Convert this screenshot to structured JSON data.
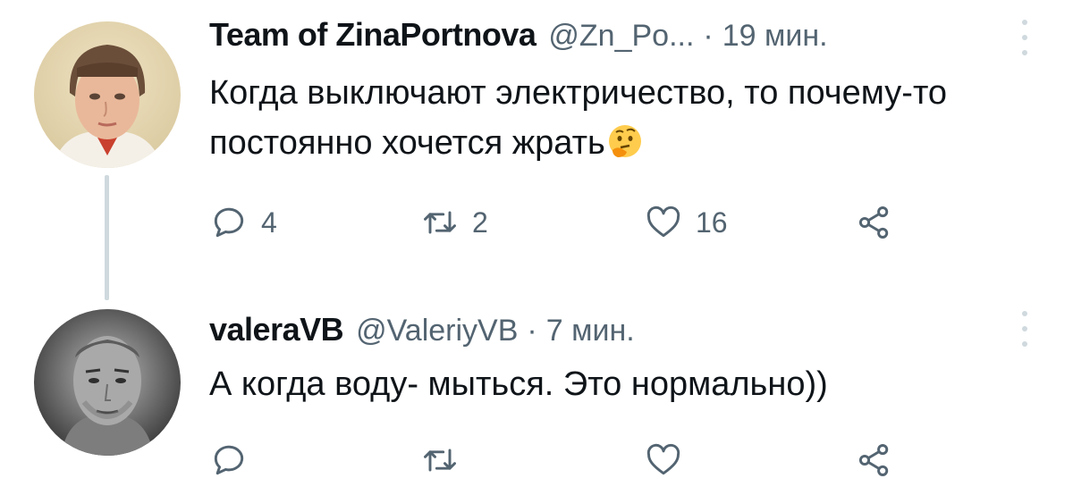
{
  "tweets": [
    {
      "name": "Team of ZinaPortnova",
      "handle": "@Zn_Po...",
      "separator": "·",
      "time": "19 мин.",
      "text": "Когда выключают электричество, то почему-то постоянно хочется жрать",
      "emoji": "thinking-face",
      "avatar": "girl-portrait",
      "actions": {
        "replies": "4",
        "retweets": "2",
        "likes": "16"
      }
    },
    {
      "name": "valeraVB",
      "handle": "@ValeriyVB",
      "separator": "·",
      "time": "7 мин.",
      "text": "А когда воду- мыться. Это нормально))",
      "avatar": "man-portrait-bw",
      "actions": {
        "replies": "",
        "retweets": "",
        "likes": ""
      }
    }
  ],
  "colors": {
    "text": "#0f1419",
    "secondary": "#536471",
    "thread_line": "#cfd9de",
    "icon": "#536471"
  }
}
